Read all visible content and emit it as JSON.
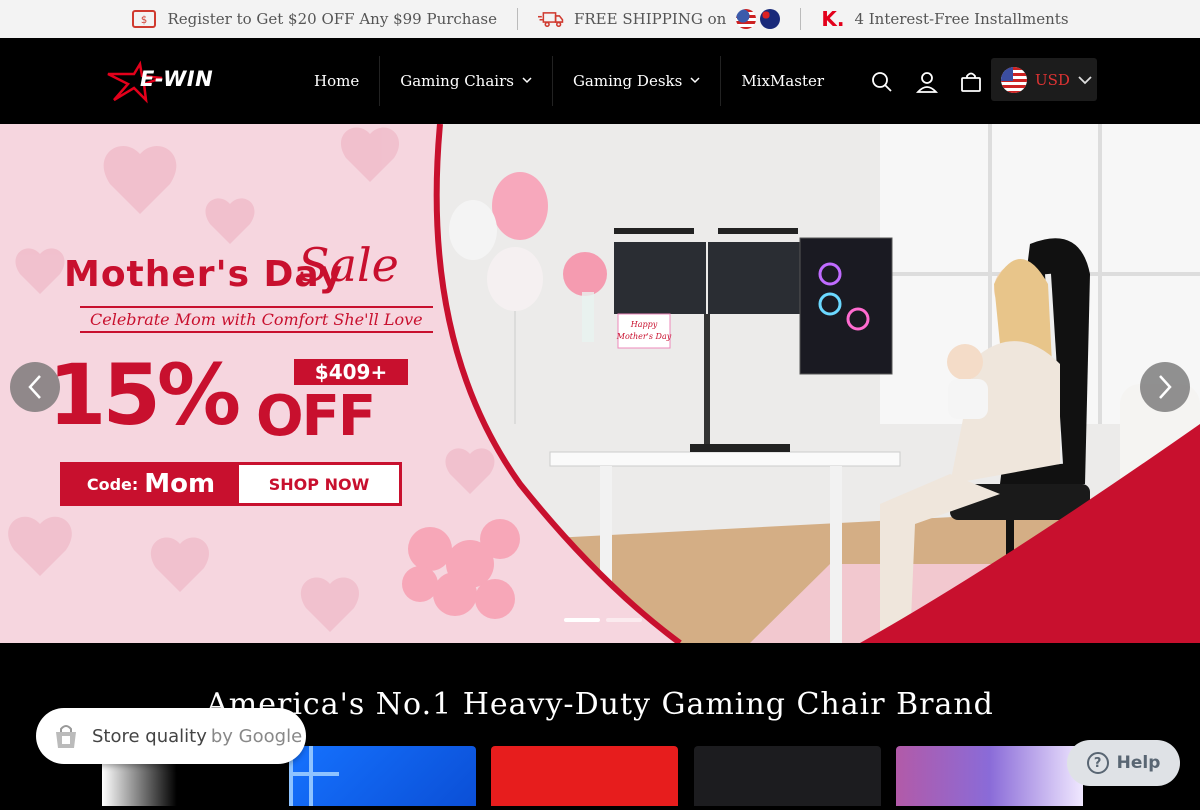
{
  "announcement": {
    "items": [
      {
        "icon": "coupon-icon",
        "text": "Register to Get $20 OFF Any $99 Purchase"
      },
      {
        "icon": "truck-icon",
        "text": "FREE SHIPPING on"
      },
      {
        "icon": "klarna-icon",
        "text": "4 Interest-Free Installments"
      }
    ],
    "klarna_mark": "K."
  },
  "header": {
    "logo_text": "E-WIN",
    "nav": [
      {
        "label": "Home",
        "has_dropdown": false
      },
      {
        "label": "Gaming Chairs",
        "has_dropdown": true
      },
      {
        "label": "Gaming Desks",
        "has_dropdown": true
      },
      {
        "label": "MixMaster",
        "has_dropdown": false
      }
    ],
    "currency": "USD",
    "icons": [
      "search-icon",
      "account-icon",
      "cart-icon"
    ]
  },
  "hero": {
    "title_part1": "Mother's Day",
    "title_part2": "Sale",
    "subtitle": "Celebrate Mom with Comfort She'll Love",
    "discount": "15%",
    "off": "OFF",
    "price_badge": "$409+",
    "code_label": "Code:",
    "code_value": "Mom",
    "cta": "SHOP NOW",
    "slide_count": 2,
    "active_slide": 1,
    "card_text": "Happy Mother's Day"
  },
  "section": {
    "title": "America's No.1 Heavy-Duty Gaming Chair Brand"
  },
  "widgets": {
    "google_label": "Store quality",
    "google_by": "by Google",
    "help_label": "Help"
  },
  "colors": {
    "brand_red": "#c8102e",
    "hero_pink": "#f6d6df",
    "header_bg": "#000000"
  }
}
